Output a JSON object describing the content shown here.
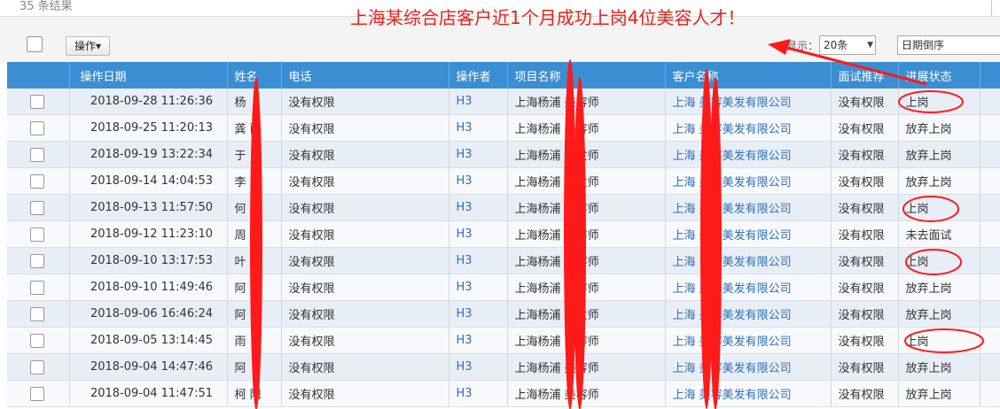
{
  "header": {
    "result_count": "35 条结果",
    "headline": "上海某综合店客户近1个月成功上岗4位美容人才！"
  },
  "toolbar": {
    "ops_label": "操作▾",
    "page_size_label": "显示：",
    "page_size_value": "20条",
    "page_size_arrow": "▼",
    "sort_value": "日期倒序"
  },
  "table": {
    "columns": [
      "操作日期",
      "姓名",
      "电话",
      "操作者",
      "项目名称",
      "客户名称",
      "面试推荐",
      "进展状态"
    ],
    "rows": [
      {
        "date": "2018-09-28 11:26:36",
        "name": "杨",
        "phone": "没有权限",
        "operator": "H3",
        "project": "上海杨浦  美容师",
        "customer": "上海  美容美发有限公司",
        "interview": "没有权限",
        "status": "上岗"
      },
      {
        "date": "2018-09-25 11:20:13",
        "name": "龚  丽",
        "phone": "没有权限",
        "operator": "H3",
        "project": "上海杨浦  美容师",
        "customer": "上海  美容美发有限公司",
        "interview": "没有权限",
        "status": "放弃上岗"
      },
      {
        "date": "2018-09-19 13:22:34",
        "name": "于",
        "phone": "没有权限",
        "operator": "H3",
        "project": "上海杨浦  美发师",
        "customer": "上海  美容美发有限公司",
        "interview": "没有权限",
        "status": "放弃上岗"
      },
      {
        "date": "2018-09-14 14:04:53",
        "name": "李",
        "phone": "没有权限",
        "operator": "H3",
        "project": "上海杨浦  美发师",
        "customer": "上海  美容美发有限公司",
        "interview": "没有权限",
        "status": "放弃上岗"
      },
      {
        "date": "2018-09-13 11:57:50",
        "name": "何  花",
        "phone": "没有权限",
        "operator": "H3",
        "project": "上海杨浦  美容师",
        "customer": "上海  美容美发有限公司",
        "interview": "没有权限",
        "status": "上岗"
      },
      {
        "date": "2018-09-12 11:23:10",
        "name": "周",
        "phone": "没有权限",
        "operator": "H3",
        "project": "上海杨浦  美容师",
        "customer": "上海  美容美发有限公司",
        "interview": "没有权限",
        "status": "未去面试"
      },
      {
        "date": "2018-09-10 13:17:53",
        "name": "叶  鹏",
        "phone": "没有权限",
        "operator": "H3",
        "project": "上海杨浦  美容师",
        "customer": "上海  美容美发有限公司",
        "interview": "没有权限",
        "status": "上岗"
      },
      {
        "date": "2018-09-10 11:49:46",
        "name": "阿",
        "phone": "没有权限",
        "operator": "H3",
        "project": "上海杨浦  美容师",
        "customer": "上海  美容美发有限公司",
        "interview": "没有权限",
        "status": "放弃上岗"
      },
      {
        "date": "2018-09-06 16:46:24",
        "name": "阿",
        "phone": "没有权限",
        "operator": "H3",
        "project": "上海杨浦  美发师",
        "customer": "上海  美容美发有限公司",
        "interview": "没有权限",
        "status": "放弃上岗"
      },
      {
        "date": "2018-09-05 13:14:45",
        "name": "雨",
        "phone": "没有权限",
        "operator": "H3",
        "project": "上海杨浦  美容师",
        "customer": "上海  美容美发有限公司",
        "interview": "没有权限",
        "status": "上岗"
      },
      {
        "date": "2018-09-04 14:47:46",
        "name": "阿",
        "phone": "没有权限",
        "operator": "H3",
        "project": "上海杨浦  美容师",
        "customer": "上海  美容美发有限公司",
        "interview": "没有权限",
        "status": "放弃上岗"
      },
      {
        "date": "2018-09-04 11:47:51",
        "name": "柯  阳",
        "phone": "没有权限",
        "operator": "H3",
        "project": "上海杨浦  美容师",
        "customer": "上海  美容美发有限公司",
        "interview": "没有权限",
        "status": "放弃上岗"
      }
    ]
  },
  "annotations": {
    "color": "#ff1a1a",
    "headline_color": "#e8211a",
    "header_color": "#3b8ed2"
  }
}
